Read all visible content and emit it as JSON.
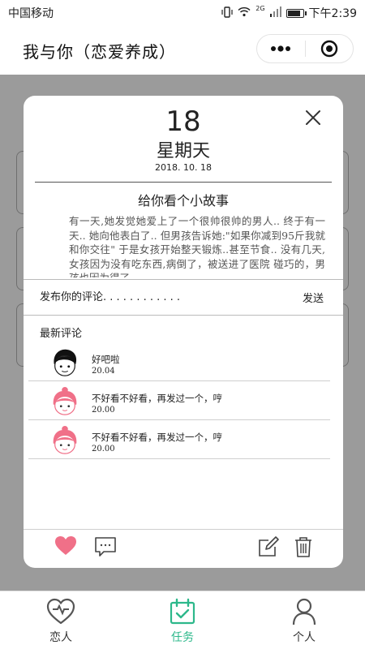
{
  "status_bar": {
    "carrier": "中国移动",
    "network_badge": "2G",
    "time": "下午2:39",
    "battery_level": 0.78,
    "icons": [
      "vibrate-icon",
      "wifi-icon",
      "signal-icon",
      "battery-icon"
    ]
  },
  "header": {
    "title": "我与你（恋爱养成）",
    "icons": [
      "more-icon",
      "close-circle-icon"
    ]
  },
  "modal": {
    "day": "18",
    "weekday": "星期天",
    "date": "2018. 10. 18",
    "story_title": "给你看个小故事",
    "story_text": "有一天,她发觉她爱上了一个很帅很帅的男人.. 终于有一天.. 她向他表白了.. 但男孩告诉她:\"如果你减到95斤我就和你交往\" 于是女孩开始整天锻炼..甚至节食.. 没有几天,女孩因为没有吃东西,病倒了，被送进了医院 碰巧的，男孩也因为得了",
    "comment_placeholder": "发布你的评论. . . . . . . . . . . .",
    "send_label": "发送",
    "latest_label": "最新评论",
    "comments": [
      {
        "avatar": "boy-avatar",
        "text": "好吧啦",
        "time": "20.04"
      },
      {
        "avatar": "girl-avatar",
        "text": "不好看不好看，再发过一个，哼",
        "time": "20.00"
      },
      {
        "avatar": "girl-avatar",
        "text": "不好看不好看，再发过一个，哼",
        "time": "20.00"
      }
    ],
    "actions": [
      "heart-icon",
      "comment-icon",
      "edit-icon",
      "trash-icon"
    ]
  },
  "tabbar": {
    "tabs": [
      {
        "label": "恋人",
        "icon": "heart-outline-icon",
        "active": false
      },
      {
        "label": "任务",
        "icon": "calendar-check-icon",
        "active": true
      },
      {
        "label": "个人",
        "icon": "person-icon",
        "active": false
      }
    ]
  },
  "colors": {
    "accent": "#2db88b",
    "heart": "#f07088",
    "backdrop": "#9b9b9b"
  }
}
